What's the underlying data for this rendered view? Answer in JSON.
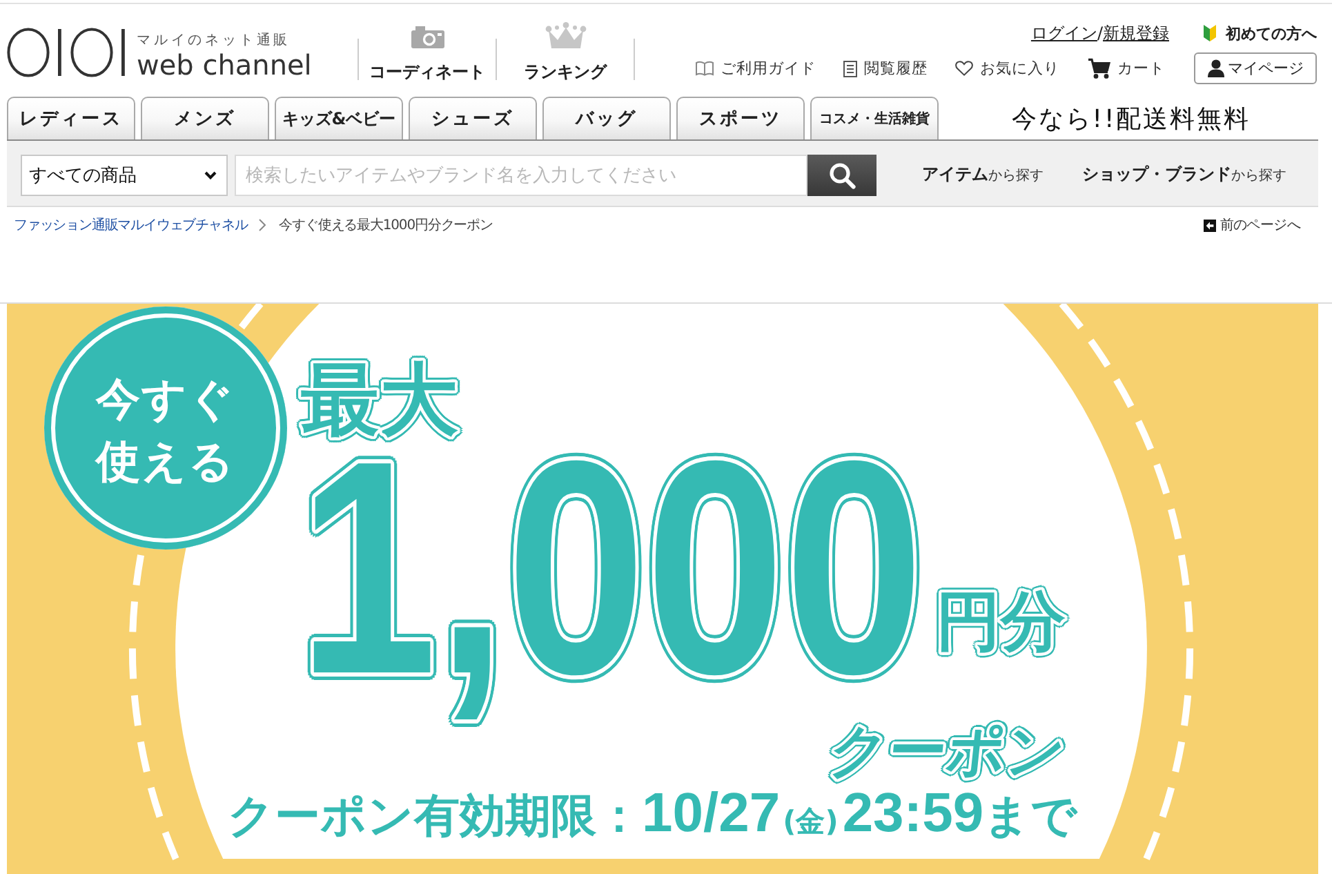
{
  "header": {
    "logo": {
      "tagline": "マルイのネット通販",
      "name": "web channel"
    },
    "nav": [
      "コーディネート",
      "ランキング"
    ],
    "account": {
      "login": "ログイン",
      "separator": "/",
      "register": "新規登録",
      "beginner": "初めての方へ"
    },
    "utility_links": [
      "ご利用ガイド",
      "閲覧履歴",
      "お気に入り",
      "カート"
    ],
    "mypage": "マイページ"
  },
  "category_tabs": [
    {
      "label": "レディース",
      "selected": false
    },
    {
      "label": "メンズ",
      "selected": false
    },
    {
      "label": "キッズ&ベビー",
      "selected": false
    },
    {
      "label": "シューズ",
      "selected": false
    },
    {
      "label": "バッグ",
      "selected": false
    },
    {
      "label": "スポーツ",
      "selected": false
    },
    {
      "label": "コスメ・生活雑貨",
      "selected": false
    }
  ],
  "promo": "今なら!!配送料無料",
  "search": {
    "scope": "すべての商品",
    "placeholder": "検索したいアイテムやブランド名を入力してください",
    "browse_links": [
      "**アイテム**から探す",
      "**ショップ・ブランド**から探す"
    ]
  },
  "breadcrumb": {
    "items": [
      "ファッション通販マルイウェブチャネル",
      "今すぐ使える最大1000円分クーポン"
    ],
    "back": "前のページへ"
  },
  "banner": {
    "badge": [
      "今すぐ",
      "使える"
    ],
    "prefix": "最大",
    "amount": "1,000",
    "unit": "円分",
    "coupon": "クーポン",
    "expiry": [
      "クーポン有効期限：",
      "10/27",
      "(金)",
      "23:59",
      "まで"
    ]
  }
}
